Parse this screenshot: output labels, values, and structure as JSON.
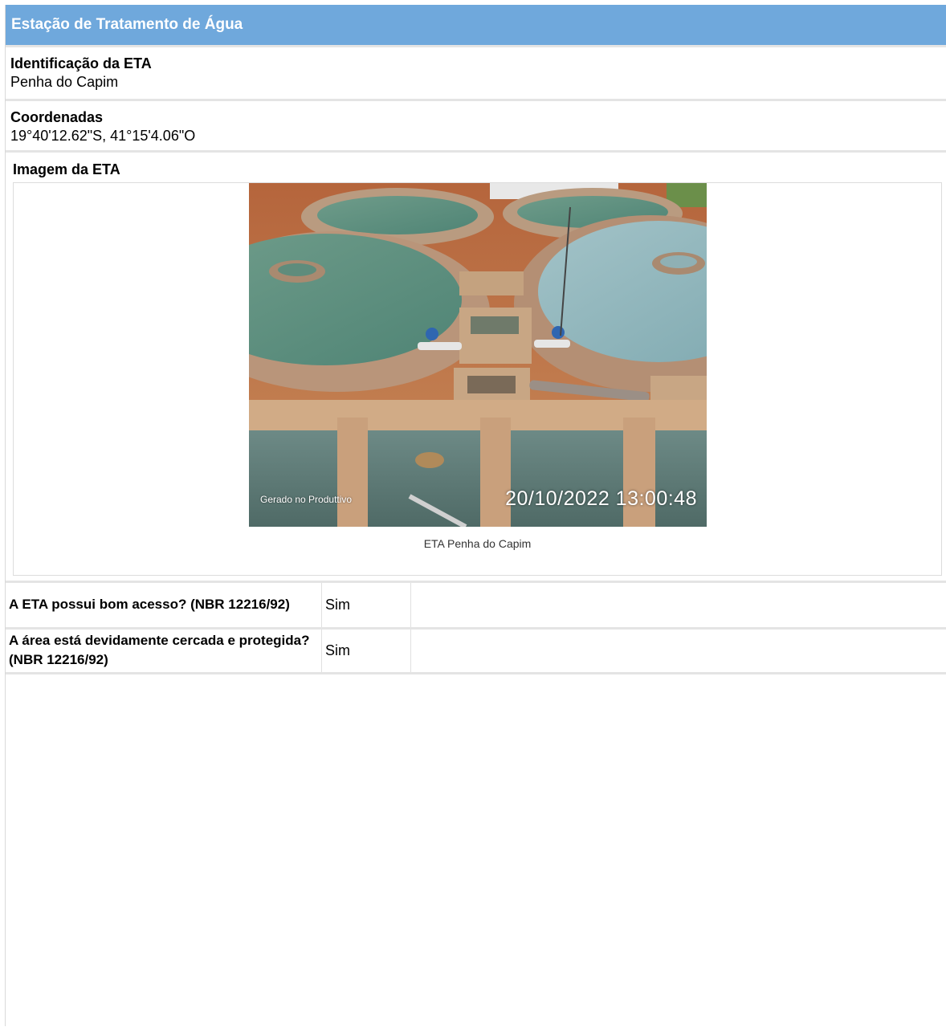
{
  "section": {
    "title": "Estação de Tratamento de Água"
  },
  "identification": {
    "label": "Identificação da ETA",
    "value": "Penha do Capim"
  },
  "coordinates": {
    "label": "Coordenadas",
    "value": "19°40'12.62\"S, 41°15'4.06\"O"
  },
  "image": {
    "label": "Imagem da ETA",
    "caption": "ETA Penha do Capim",
    "watermark": "Gerado no Produttivo",
    "timestamp": "20/10/2022 13:00:48"
  },
  "questions": [
    {
      "question": "A ETA possui bom acesso? (NBR 12216/92)",
      "answer": "Sim"
    },
    {
      "question": "A área está devidamente cercada e protegida? (NBR 12216/92)",
      "answer": "Sim"
    }
  ]
}
